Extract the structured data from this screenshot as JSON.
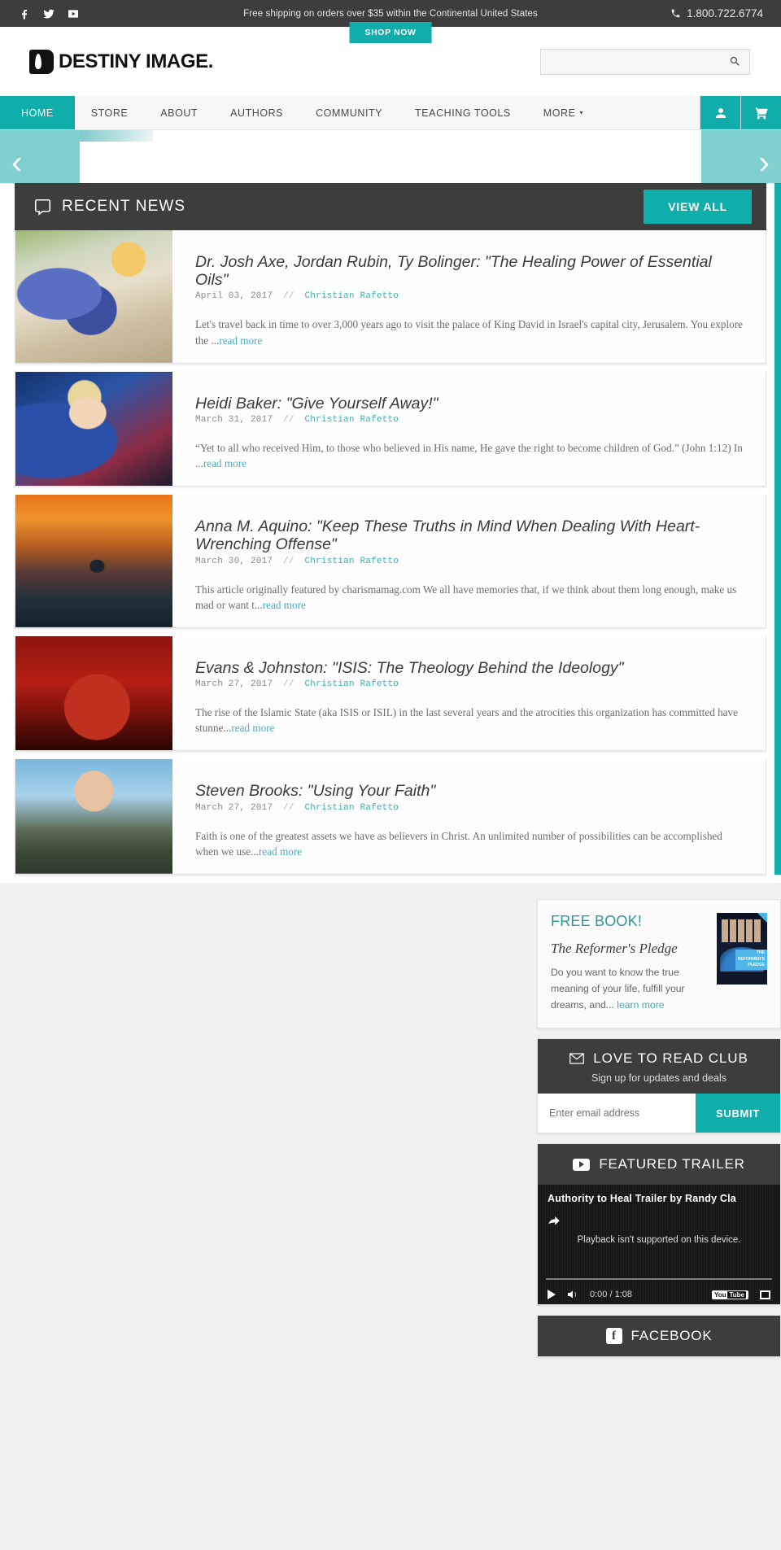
{
  "topbar": {
    "shipping_message": "Free shipping on orders over $35 within the Continental United States",
    "shop_now": "SHOP NOW",
    "phone": "1.800.722.6774",
    "social": [
      {
        "name": "facebook-icon",
        "label": "Facebook"
      },
      {
        "name": "twitter-icon",
        "label": "Twitter"
      },
      {
        "name": "youtube-icon",
        "label": "YouTube"
      }
    ]
  },
  "header": {
    "logo_text": "DESTINY IMAGE.",
    "search_placeholder": "",
    "search_value": ""
  },
  "nav": {
    "items": [
      {
        "label": "HOME",
        "active": true
      },
      {
        "label": "STORE",
        "active": false
      },
      {
        "label": "ABOUT",
        "active": false
      },
      {
        "label": "AUTHORS",
        "active": false
      },
      {
        "label": "COMMUNITY",
        "active": false
      },
      {
        "label": "TEACHING TOOLS",
        "active": false
      },
      {
        "label": "MORE",
        "active": false,
        "caret": true
      }
    ],
    "account_icon": "user-icon",
    "cart_icon": "cart-icon"
  },
  "carousel": {
    "prev": "‹",
    "next": "›"
  },
  "recent_news": {
    "title": "RECENT NEWS",
    "view_all": "VIEW ALL",
    "articles": [
      {
        "title": "Dr. Josh Axe, Jordan Rubin, Ty Bolinger: \"The Healing Power of Essential Oils\"",
        "date": "April 03, 2017",
        "separator": "//",
        "author": "Christian Rafetto",
        "excerpt": "Let's travel back in time to over 3,000 years ago to visit the palace of King David in Israel's capital city, Jerusalem. You explore the ...",
        "read_more": "read more",
        "thumb_class": "thumb-oils"
      },
      {
        "title": "Heidi Baker: \"Give Yourself Away!\"",
        "date": "March 31, 2017",
        "separator": "//",
        "author": "Christian Rafetto",
        "excerpt": "“Yet to all who received Him, to those who believed in His name, He gave the right to become children of God.” (John 1:12) In ...",
        "read_more": "read more",
        "thumb_class": "thumb-heidi"
      },
      {
        "title": "Anna M. Aquino: \"Keep These Truths in Mind When Dealing With Heart-Wrenching Offense\"",
        "date": "March 30, 2017",
        "separator": "//",
        "author": "Christian Rafetto",
        "excerpt": "This article originally featured by charismamag.com We all have memories that, if we think about them long enough, make us mad or want t...",
        "read_more": "read more",
        "thumb_class": "thumb-sunset"
      },
      {
        "title": "Evans & Johnston: \"ISIS: The Theology Behind the Ideology\"",
        "date": "March 27, 2017",
        "separator": "//",
        "author": "Christian Rafetto",
        "excerpt": "The rise of the Islamic State (aka ISIS or ISIL) in the last several years and the atrocities this organization has committed have stunne...",
        "read_more": "read more",
        "thumb_class": "thumb-isis"
      },
      {
        "title": "Steven Brooks: \"Using Your Faith\"",
        "date": "March 27, 2017",
        "separator": "//",
        "author": "Christian Rafetto",
        "excerpt": "Faith is one of the greatest assets we have as believers in Christ. An unlimited number of possibilities can be accomplished when we use...",
        "read_more": "read more",
        "thumb_class": "thumb-steven"
      }
    ]
  },
  "sidebar": {
    "free_book": {
      "heading": "FREE BOOK!",
      "book_title": "The Reformer's Pledge",
      "description": "Do you want to know the true meaning of your life, fulfill your dreams, and... ",
      "link": "learn more",
      "cover_line1": "THE",
      "cover_line2": "REFORMER'S",
      "cover_line3": "PLEDGE"
    },
    "love_to_read": {
      "title": "LOVE TO READ CLUB",
      "subtitle": "Sign up for updates and deals",
      "email_placeholder": "Enter email address",
      "email_value": "",
      "submit": "SUBMIT",
      "icon": "mail-icon"
    },
    "featured_trailer": {
      "title": "FEATURED TRAILER",
      "video_title": "Authority to Heal Trailer by Randy Cla",
      "playback_message": "Playback isn't supported on this device.",
      "time": "0:00 / 1:08",
      "yt_label_1": "You",
      "yt_label_2": "Tube",
      "icon": "youtube-play-icon"
    },
    "facebook": {
      "title": "FACEBOOK",
      "icon": "facebook-icon"
    }
  },
  "colors": {
    "accent": "#0faeab",
    "dark": "#3d3d3d",
    "link": "#3fb0ae",
    "readmore": "#4aaec4"
  }
}
